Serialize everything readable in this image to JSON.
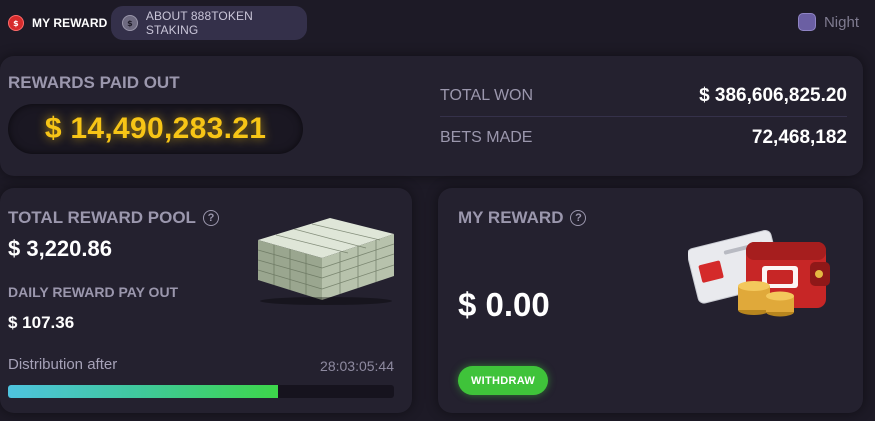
{
  "nav": {
    "my_reward_tab": "MY REWARD",
    "about_tab": "ABOUT 888TOKEN STAKING",
    "night_label": "Night",
    "coin_glyph": "$"
  },
  "summary": {
    "rewards_paid_out_label": "REWARDS PAID OUT",
    "rewards_paid_out_value": "$ 14,490,283.21",
    "total_won_label": "TOTAL WON",
    "total_won_value": "$ 386,606,825.20",
    "bets_made_label": "BETS MADE",
    "bets_made_value": "72,468,182"
  },
  "pool": {
    "title": "TOTAL REWARD POOL",
    "value": "$ 3,220.86",
    "daily_label": "DAILY REWARD PAY OUT",
    "daily_value": "$ 107.36",
    "distribution_label": "Distribution after",
    "distribution_timer": "28:03:05:44",
    "progress_fraction": 0.7
  },
  "my_reward": {
    "title": "MY REWARD",
    "value": "$ 0.00",
    "withdraw_label": "WITHDRAW"
  },
  "icons": {
    "help": "?",
    "coin": "coin-icon",
    "money_stack": "money-stack-icon",
    "wallet": "wallet-icon"
  },
  "colors": {
    "accent_gold": "#f7c516",
    "withdraw_green": "#3fc33a",
    "background": "#1d1a26",
    "panel": "#24212f"
  }
}
